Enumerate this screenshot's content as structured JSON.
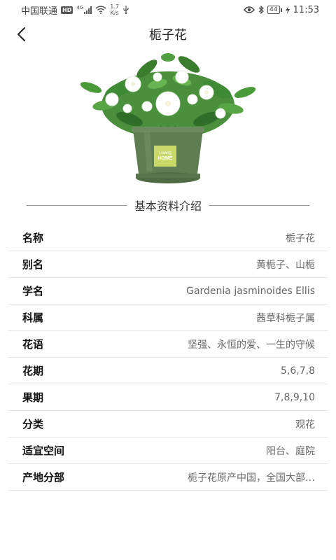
{
  "status_bar": {
    "carrier": "中国联通",
    "hd": "HD",
    "network": "4G",
    "speed_value": "1.7",
    "speed_unit": "K/s",
    "battery": "44",
    "time": "11:53"
  },
  "header": {
    "title": "栀子花"
  },
  "section": {
    "title": "基本资料介绍"
  },
  "pot_label": {
    "line1": "Loving",
    "line2": "HOME"
  },
  "info": [
    {
      "label": "名称",
      "value": "栀子花"
    },
    {
      "label": "别名",
      "value": "黄栀子、山栀"
    },
    {
      "label": "学名",
      "value": "Gardenia jasminoides Ellis"
    },
    {
      "label": "科属",
      "value": "茜草科栀子属"
    },
    {
      "label": "花语",
      "value": "坚强、永恒的爱、一生的守候"
    },
    {
      "label": "花期",
      "value": "5,6,7,8"
    },
    {
      "label": "果期",
      "value": "7,8,9,10"
    },
    {
      "label": "分类",
      "value": "观花"
    },
    {
      "label": "适宜空间",
      "value": "阳台、庭院"
    },
    {
      "label": "产地分部",
      "value": "栀子花原产中国，全国大部…"
    }
  ],
  "colors": {
    "pot": "#5f7d52",
    "leaf": "#3f8a34",
    "flower": "#ffffff"
  }
}
